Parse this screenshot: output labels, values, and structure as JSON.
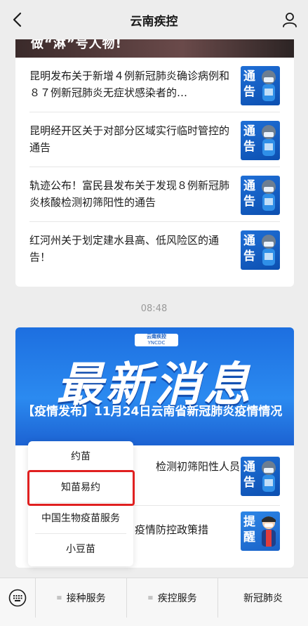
{
  "header": {
    "title": "云南疾控"
  },
  "card1": {
    "banner_text": "做“淋”号人物!",
    "items": [
      {
        "text": "昆明发布关于新增４例新冠肺炎确诊病例和８７例新冠肺炎无症状感染者的…",
        "thumb_label": "通告"
      },
      {
        "text": "昆明经开区关于对部分区域实行临时管控的通告",
        "thumb_label": "通告"
      },
      {
        "text": "轨迹公布！富民县发布关于发现８例新冠肺炎核酸检测初筛阳性的通告",
        "thumb_label": "通告"
      },
      {
        "text": "红河州关于划定建水县高、低风险区的通告！",
        "thumb_label": "通告"
      }
    ]
  },
  "time": "08:48",
  "card2": {
    "logo_line1": "云南疾控",
    "logo_line2": "YNCDC",
    "hero_big": "最新消息",
    "hero_title": "【疫情发布】11月24日云南省新冠肺炎疫情情况",
    "items": [
      {
        "text": "检测初筛阳性人员",
        "thumb_label": "通告"
      },
      {
        "text": "疫情防控政策措",
        "thumb_label": "提醒"
      }
    ]
  },
  "popup": {
    "items": [
      "约苗",
      "知苗易约",
      "中国生物疫苗服务",
      "小豆苗"
    ]
  },
  "bottombar": {
    "tabs": [
      "接种服务",
      "疾控服务",
      "新冠肺炎"
    ]
  },
  "colors": {
    "highlight": "#e02020",
    "thumb_blue": "#1f6fd6"
  }
}
